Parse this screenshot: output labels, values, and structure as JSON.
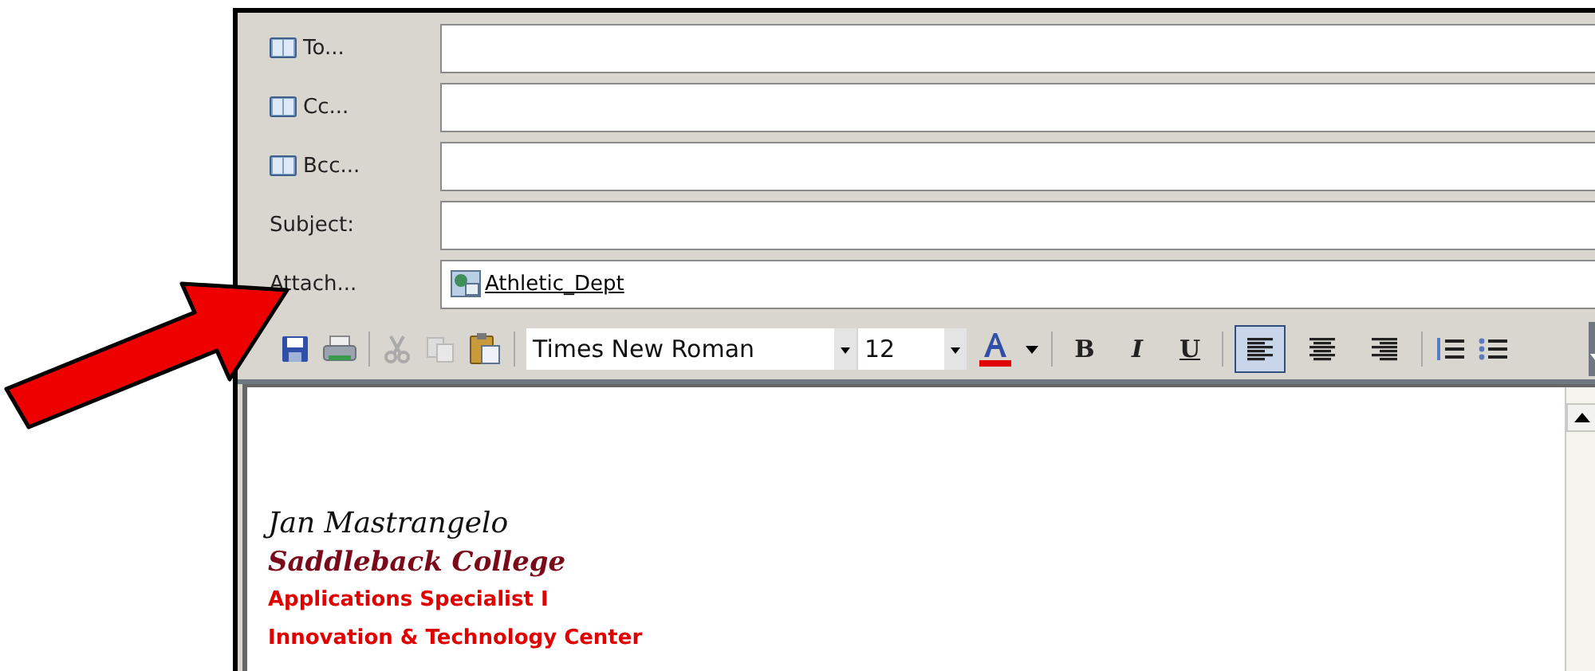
{
  "header_fields": [
    {
      "label": "To...",
      "kind": "address"
    },
    {
      "label": "Cc...",
      "kind": "address"
    },
    {
      "label": "Bcc...",
      "kind": "address"
    },
    {
      "label": "Subject:",
      "kind": "plain"
    }
  ],
  "attach": {
    "label": "Attach...",
    "file": "Athletic_Dept"
  },
  "toolbar": {
    "font": "Times New Roman",
    "size": "12",
    "format_buttons": [
      {
        "kind": "bold",
        "label": "B"
      },
      {
        "kind": "italic",
        "label": "I"
      },
      {
        "kind": "underline",
        "label": "U"
      }
    ],
    "align_buttons": [
      {
        "kind": "left",
        "selected": true
      },
      {
        "kind": "center",
        "selected": false
      },
      {
        "kind": "right",
        "selected": false
      }
    ]
  },
  "signature": [
    {
      "kind": "name",
      "text": "Jan Mastrangelo"
    },
    {
      "kind": "org",
      "text": "Saddleback College"
    },
    {
      "kind": "detail",
      "text": "Applications Specialist I"
    },
    {
      "kind": "detail",
      "text": "Innovation & Technology Center"
    }
  ]
}
